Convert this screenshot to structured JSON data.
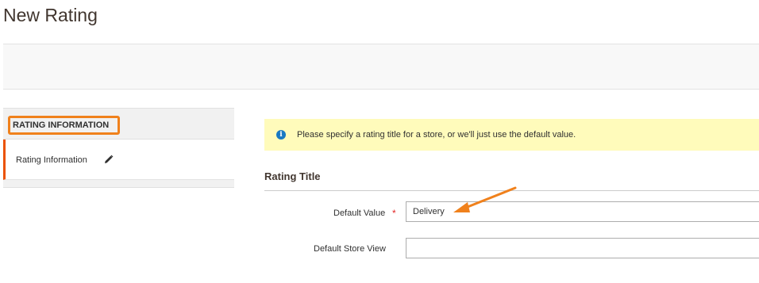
{
  "page": {
    "title": "New Rating"
  },
  "sidebar": {
    "header_label": "RATING INFORMATION",
    "items": [
      {
        "label": "Rating Information",
        "icon": "pencil-icon"
      }
    ]
  },
  "message": {
    "icon": "info-icon",
    "icon_glyph": "i",
    "text": "Please specify a rating title for a store, or we'll just use the default value."
  },
  "fieldset": {
    "title": "Rating Title",
    "fields": [
      {
        "label": "Default Value",
        "required": true,
        "required_mark": "*",
        "value": "Delivery"
      },
      {
        "label": "Default Store View",
        "required": false,
        "value": ""
      }
    ]
  },
  "annotations": {
    "highlight_color": "#f0811c",
    "arrow_color": "#f0811c"
  },
  "colors": {
    "accent": "#eb5202",
    "message_bg": "#fffbbb",
    "info_blue": "#1979c3"
  }
}
